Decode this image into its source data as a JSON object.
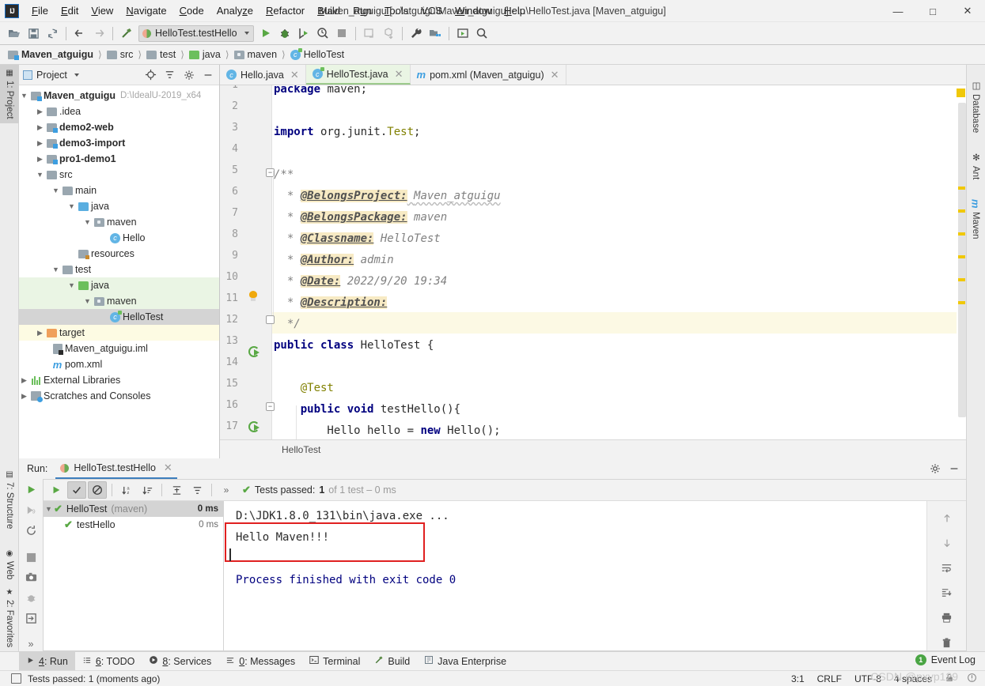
{
  "window": {
    "title": "Maven_atguigu [...\\atguigu\\Maven_atguigu] - ...\\HelloTest.java [Maven_atguigu]",
    "minimize": "—",
    "maximize": "☐",
    "close": "✕"
  },
  "menu": [
    {
      "label": "File"
    },
    {
      "label": "Edit"
    },
    {
      "label": "View"
    },
    {
      "label": "Navigate"
    },
    {
      "label": "Code"
    },
    {
      "label": "Analyze"
    },
    {
      "label": "Refactor"
    },
    {
      "label": "Build"
    },
    {
      "label": "Run"
    },
    {
      "label": "Tools"
    },
    {
      "label": "VCS"
    },
    {
      "label": "Window"
    },
    {
      "label": "Help"
    }
  ],
  "toolbar": {
    "run_config": "HelloTest.testHello",
    "icons": [
      "open-folder-icon",
      "save-all-icon",
      "sync-icon",
      "back-arrow-icon",
      "forward-arrow-icon",
      "build-hammer-icon",
      "run-icon",
      "debug-icon",
      "run-coverage-icon",
      "profile-icon",
      "stop-icon",
      "update-project-icon",
      "commit-icon",
      "settings-wrench-icon",
      "project-structure-icon",
      "run-anything-icon",
      "search-icon"
    ]
  },
  "breadcrumb": [
    {
      "label": "Maven_atguigu",
      "icon": "module-icon",
      "bold": true
    },
    {
      "label": "src",
      "icon": "folder-icon",
      "bold": false
    },
    {
      "label": "test",
      "icon": "folder-icon",
      "bold": false
    },
    {
      "label": "java",
      "icon": "test-source-folder-icon",
      "bold": false
    },
    {
      "label": "maven",
      "icon": "package-icon",
      "bold": false
    },
    {
      "label": "HelloTest",
      "icon": "test-class-icon",
      "bold": false
    }
  ],
  "left_stripe": [
    {
      "label": "1: Project",
      "icon": "project-icon",
      "active": true
    },
    {
      "label": "7: Structure",
      "icon": "structure-icon",
      "active": false
    },
    {
      "label": "Web",
      "icon": "web-icon",
      "active": false
    },
    {
      "label": "2: Favorites",
      "icon": "star-icon",
      "active": false
    }
  ],
  "right_stripe": [
    {
      "label": "Database",
      "icon": "database-icon"
    },
    {
      "label": "Ant",
      "icon": "ant-icon"
    },
    {
      "label": "Maven",
      "icon": "maven-icon"
    }
  ],
  "project_panel": {
    "title": "Project",
    "header_icons": [
      "locate-icon",
      "collapse-all-icon",
      "gear-icon",
      "hide-icon"
    ],
    "tree": [
      {
        "depth": 0,
        "arrow": "v",
        "icon": "module-icon",
        "label": "Maven_atguigu",
        "bold": true,
        "path": "D:\\IdealU-2019_x64",
        "state": "none"
      },
      {
        "depth": 1,
        "arrow": ">",
        "icon": "folder-icon",
        "label": ".idea",
        "bold": false,
        "path": "",
        "state": "none"
      },
      {
        "depth": 1,
        "arrow": ">",
        "icon": "module-icon",
        "label": "demo2-web",
        "bold": true,
        "path": "",
        "state": "none"
      },
      {
        "depth": 1,
        "arrow": ">",
        "icon": "module-icon",
        "label": "demo3-import",
        "bold": true,
        "path": "",
        "state": "none"
      },
      {
        "depth": 1,
        "arrow": ">",
        "icon": "module-icon",
        "label": "pro1-demo1",
        "bold": true,
        "path": "",
        "state": "none"
      },
      {
        "depth": 1,
        "arrow": "v",
        "icon": "folder-icon",
        "label": "src",
        "bold": false,
        "path": "",
        "state": "none"
      },
      {
        "depth": 2,
        "arrow": "v",
        "icon": "folder-icon",
        "label": "main",
        "bold": false,
        "path": "",
        "state": "none"
      },
      {
        "depth": 3,
        "arrow": "v",
        "icon": "source-folder-icon",
        "label": "java",
        "bold": false,
        "path": "",
        "state": "none"
      },
      {
        "depth": 4,
        "arrow": "v",
        "icon": "package-icon",
        "label": "maven",
        "bold": false,
        "path": "",
        "state": "none"
      },
      {
        "depth": 5,
        "arrow": "",
        "icon": "class-icon",
        "label": "Hello",
        "bold": false,
        "path": "",
        "state": "none"
      },
      {
        "depth": 3,
        "arrow": "",
        "icon": "resources-folder-icon",
        "label": "resources",
        "bold": false,
        "path": "",
        "state": "none"
      },
      {
        "depth": 2,
        "arrow": "v",
        "icon": "folder-icon",
        "label": "test",
        "bold": false,
        "path": "",
        "state": "none"
      },
      {
        "depth": 3,
        "arrow": "v",
        "icon": "test-source-folder-icon",
        "label": "java",
        "bold": false,
        "path": "",
        "state": "green"
      },
      {
        "depth": 4,
        "arrow": "v",
        "icon": "package-icon",
        "label": "maven",
        "bold": false,
        "path": "",
        "state": "green"
      },
      {
        "depth": 5,
        "arrow": "",
        "icon": "test-class-icon",
        "label": "HelloTest",
        "bold": false,
        "path": "",
        "state": "selected"
      },
      {
        "depth": 1,
        "arrow": ">",
        "icon": "target-folder-icon",
        "label": "target",
        "bold": false,
        "path": "",
        "state": "yellow"
      },
      {
        "depth": 2,
        "arrow": "",
        "icon": "iml-icon",
        "label": "Maven_atguigu.iml",
        "bold": false,
        "path": "",
        "state": "none"
      },
      {
        "depth": 2,
        "arrow": "",
        "icon": "maven-pom-icon",
        "label": "pom.xml",
        "bold": false,
        "path": "",
        "state": "none"
      },
      {
        "depth": 0,
        "arrow": ">",
        "icon": "external-libraries-icon",
        "label": "External Libraries",
        "bold": false,
        "path": "",
        "state": "none"
      },
      {
        "depth": 0,
        "arrow": ">",
        "icon": "scratches-icon",
        "label": "Scratches and Consoles",
        "bold": false,
        "path": "",
        "state": "none"
      }
    ]
  },
  "editor": {
    "tabs": [
      {
        "label": "Hello.java",
        "icon": "class-icon",
        "active": false
      },
      {
        "label": "HelloTest.java",
        "icon": "test-class-icon",
        "active": true
      },
      {
        "label": "pom.xml (Maven_atguigu)",
        "icon": "maven-pom-icon",
        "active": false
      }
    ],
    "breadcrumb": "HelloTest",
    "lines": [
      {
        "no": 1,
        "text": "package maven;"
      },
      {
        "no": 2,
        "text": ""
      },
      {
        "no": 3,
        "text": "import org.junit.Test;"
      },
      {
        "no": 4,
        "text": ""
      },
      {
        "no": 5,
        "text": "/**"
      },
      {
        "no": 6,
        "text": " * @BelongsProject: Maven_atguigu"
      },
      {
        "no": 7,
        "text": " * @BelongsPackage: maven"
      },
      {
        "no": 8,
        "text": " * @Classname: HelloTest"
      },
      {
        "no": 9,
        "text": " * @Author: admin"
      },
      {
        "no": 10,
        "text": " * @Date: 2022/9/20 19:34"
      },
      {
        "no": 11,
        "text": " * @Description:"
      },
      {
        "no": 12,
        "text": " */"
      },
      {
        "no": 13,
        "text": "public class HelloTest {"
      },
      {
        "no": 14,
        "text": ""
      },
      {
        "no": 15,
        "text": "    @Test"
      },
      {
        "no": 16,
        "text": "    public void testHello(){"
      },
      {
        "no": 17,
        "text": "        Hello hello = new Hello();"
      }
    ],
    "javadoc": {
      "tag_project": "@BelongsProject:",
      "val_project": "Maven_atguigu",
      "tag_package": "@BelongsPackage:",
      "val_package": "maven",
      "tag_classname": "@Classname:",
      "val_classname": "HelloTest",
      "tag_author": "@Author:",
      "val_author": "admin",
      "tag_date": "@Date:",
      "val_date": "2022/9/20 19:34",
      "tag_description": "@Description:",
      "val_description": ""
    }
  },
  "run_panel": {
    "label": "Run:",
    "tab": "HelloTest.testHello",
    "toolbar_icons": [
      "rerun-icon",
      "rerun-failed-icon",
      "restart-icon",
      "stop-icon",
      "screenshot-icon",
      "debug-icon",
      "export-icon",
      "expand-icon"
    ],
    "test_toolbar_icons": [
      "run-icon",
      "show-passed-icon",
      "hide-ignored-icon",
      "sort-alphabetically-icon",
      "sort-by-duration-icon",
      "expand-all-icon",
      "collapse-all-icon",
      "more-icon"
    ],
    "status_prefix": "Tests passed:",
    "status_count": "1",
    "status_suffix": "of 1 test – 0 ms",
    "tests": [
      {
        "label": "HelloTest",
        "suffix": "(maven)",
        "time": "0 ms",
        "depth": 0,
        "selected": true,
        "arrow": "v"
      },
      {
        "label": "testHello",
        "suffix": "",
        "time": "0 ms",
        "depth": 1,
        "selected": false,
        "arrow": ""
      }
    ],
    "console": {
      "command": "D:\\JDK1.8.0_131\\bin\\java.exe ...",
      "output": "Hello Maven!!!",
      "finished": "Process finished with exit code 0"
    },
    "console_tool_icons": [
      "up-arrow-icon",
      "down-arrow-icon",
      "soft-wrap-icon",
      "scroll-to-end-icon",
      "print-icon",
      "trash-icon"
    ],
    "header_icons": [
      "gear-icon",
      "hide-icon"
    ]
  },
  "bottom_bar": [
    {
      "label": "4: Run",
      "mnemonic": "4",
      "icon": "run-icon",
      "active": true
    },
    {
      "label": "6: TODO",
      "mnemonic": "6",
      "icon": "todo-icon",
      "active": false
    },
    {
      "label": "8: Services",
      "mnemonic": "8",
      "icon": "services-icon",
      "active": false
    },
    {
      "label": "0: Messages",
      "mnemonic": "0",
      "icon": "messages-icon",
      "active": false
    },
    {
      "label": "Terminal",
      "mnemonic": "",
      "icon": "terminal-icon",
      "active": false
    },
    {
      "label": "Build",
      "mnemonic": "",
      "icon": "build-icon",
      "active": false
    },
    {
      "label": "Java Enterprise",
      "mnemonic": "",
      "icon": "java-enterprise-icon",
      "active": false
    }
  ],
  "status_bar": {
    "message": "Tests passed: 1 (moments ago)",
    "caret": "3:1",
    "line_separator": "CRLF",
    "encoding": "UTF-8",
    "indent": "4 spaces",
    "event_log": "Event Log",
    "event_badge": "1"
  },
  "watermark": "CSDN @pxyp129",
  "colors": {
    "accent_blue": "#3d7ebd",
    "pass_green": "#59a844",
    "warn_yellow": "#f0c808",
    "error_red": "#e02020",
    "selection_gray": "#d4d4d4"
  }
}
